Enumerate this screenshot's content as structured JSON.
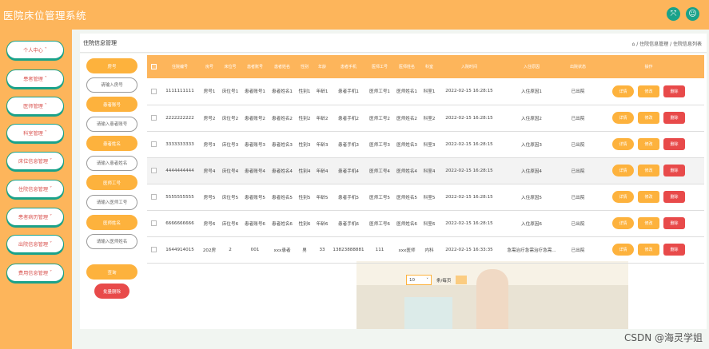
{
  "header": {
    "title": "医院床位管理系统"
  },
  "sidebar": {
    "items": [
      {
        "label": "个人中心"
      },
      {
        "label": "患者管理"
      },
      {
        "label": "医师管理"
      },
      {
        "label": "科室管理"
      },
      {
        "label": "床位信息管理"
      },
      {
        "label": "住院信息管理"
      },
      {
        "label": "患者病历管理"
      },
      {
        "label": "出院信息管理"
      },
      {
        "label": "费用信息管理"
      }
    ]
  },
  "breadcrumb": {
    "title": "住院信息管理",
    "path": "⌂ / 住院信息管理 / 住院信息列表"
  },
  "search": {
    "fields": [
      {
        "label": "房号",
        "placeholder": "请输入房号"
      },
      {
        "label": "患者账号",
        "placeholder": "请输入患者账号"
      },
      {
        "label": "患者姓名",
        "placeholder": "请输入患者姓名"
      },
      {
        "label": "医师工号",
        "placeholder": "请输入医师工号"
      },
      {
        "label": "医师姓名",
        "placeholder": "请输入医师姓名"
      }
    ],
    "search_label": "查询",
    "batch_delete_label": "批量删除"
  },
  "table": {
    "headers": [
      "住院编号",
      "房号",
      "床位号",
      "患者账号",
      "患者姓名",
      "性别",
      "年龄",
      "患者手机",
      "医师工号",
      "医师姓名",
      "科室",
      "入院时间",
      "入住原因",
      "出院状态",
      "操作"
    ],
    "rows": [
      [
        "1111111111",
        "房号1",
        "床位号1",
        "患者账号1",
        "患者姓名1",
        "性别1",
        "年龄1",
        "患者手机1",
        "医师工号1",
        "医师姓名1",
        "科室1",
        "2022-02-15 16:28:15",
        "入住原因1",
        "已出院"
      ],
      [
        "2222222222",
        "房号2",
        "床位号2",
        "患者账号2",
        "患者姓名2",
        "性别2",
        "年龄2",
        "患者手机2",
        "医师工号2",
        "医师姓名2",
        "科室2",
        "2022-02-15 16:28:15",
        "入住原因2",
        "已出院"
      ],
      [
        "3333333333",
        "房号3",
        "床位号3",
        "患者账号3",
        "患者姓名3",
        "性别3",
        "年龄3",
        "患者手机3",
        "医师工号3",
        "医师姓名3",
        "科室3",
        "2022-02-15 16:28:15",
        "入住原因3",
        "已出院"
      ],
      [
        "4444444444",
        "房号4",
        "床位号4",
        "患者账号4",
        "患者姓名4",
        "性别4",
        "年龄4",
        "患者手机4",
        "医师工号4",
        "医师姓名4",
        "科室4",
        "2022-02-15 16:28:15",
        "入住原因4",
        "已出院"
      ],
      [
        "5555555555",
        "房号5",
        "床位号5",
        "患者账号5",
        "患者姓名5",
        "性别5",
        "年龄5",
        "患者手机5",
        "医师工号5",
        "医师姓名5",
        "科室5",
        "2022-02-15 16:28:15",
        "入住原因5",
        "已出院"
      ],
      [
        "6666666666",
        "房号6",
        "床位号6",
        "患者账号6",
        "患者姓名6",
        "性别6",
        "年龄6",
        "患者手机6",
        "医师工号6",
        "医师姓名6",
        "科室6",
        "2022-02-15 16:28:15",
        "入住原因6",
        "已出院"
      ],
      [
        "1644914015",
        "202房",
        "2",
        "001",
        "xxx患者",
        "男",
        "33",
        "13823888881",
        "111",
        "xxx医师",
        "内科",
        "2022-02-15 16:33:35",
        "急需治疗急需治疗急需...",
        "已出院"
      ]
    ],
    "actions": {
      "detail": "详情",
      "edit": "修改",
      "delete": "删除"
    }
  },
  "pagination": {
    "page_size": "10",
    "page_text": "条/每页"
  },
  "watermark": "CSDN @海灵学姐",
  "colors": {
    "primary": "#fdb55b",
    "accent": "#fdb23d",
    "danger": "#e84a4a",
    "teal": "#1aa28a"
  }
}
